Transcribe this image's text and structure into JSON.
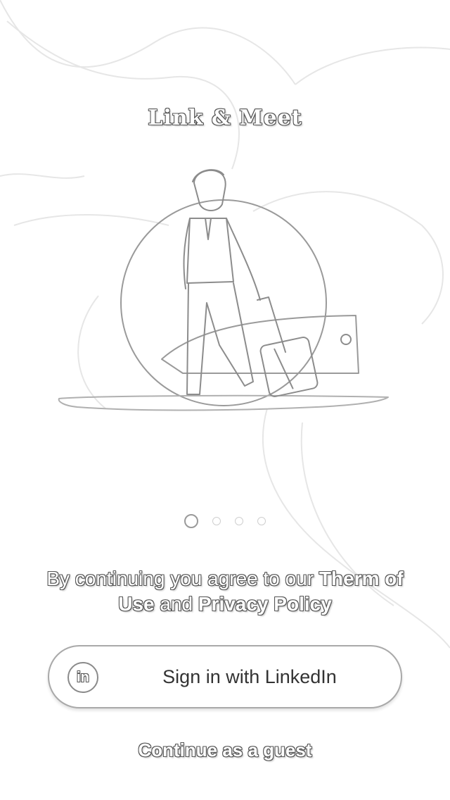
{
  "app": {
    "title": "Link & Meet"
  },
  "onboarding": {
    "page_count": 4,
    "active_page": 1,
    "illustration_icon": "traveler-with-suitcase-illustration"
  },
  "terms": {
    "prefix": "By continuing you agree to our ",
    "link_1": "Therm of Use",
    "middle": " and ",
    "link_2": "Privacy Policy"
  },
  "actions": {
    "linkedin_icon_text": "in",
    "linkedin_label": "Sign in with LinkedIn",
    "guest_label": "Continue as a guest"
  }
}
